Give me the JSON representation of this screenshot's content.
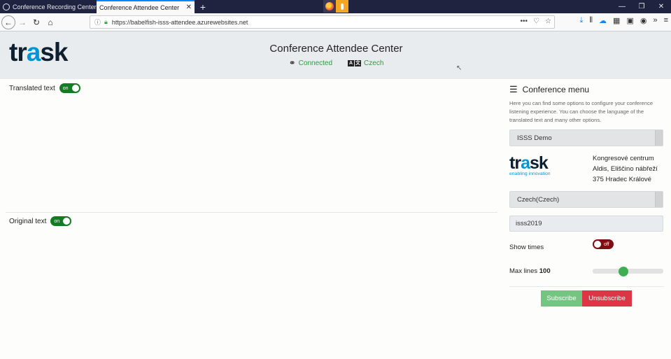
{
  "browser": {
    "tabs": [
      {
        "title": "Conference Recording Center",
        "active": false
      },
      {
        "title": "Conference Attendee Center",
        "active": true
      }
    ],
    "new_tab_icon": "plus-icon",
    "url": "https://babelfish-isss-attendee.azurewebsites.net",
    "window_controls": [
      "minimize-icon",
      "restore-icon",
      "close-icon"
    ]
  },
  "header": {
    "logo": {
      "text_a": "tr",
      "text_b": "a",
      "text_c": "sk"
    },
    "title": "Conference Attendee Center",
    "status_connected": "Connected",
    "status_language": "Czech"
  },
  "panels": {
    "translated_label": "Translated text",
    "translated_switch": "on",
    "original_label": "Original text",
    "original_switch": "on"
  },
  "sidebar": {
    "title": "Conference menu",
    "description": "Here you can find some options to configure your conference listening experience. You can choose the language of the translated text and many other options.",
    "conference_select": "ISSS Demo",
    "venue_logo_tagline": "enabling innovation",
    "venue_lines": [
      "Kongresové centrum",
      "Aldis, Eliščino nábřeží",
      "375 Hradec Králové"
    ],
    "language_select": "Czech(Czech)",
    "code_input": "isss2019",
    "show_times_label": "Show times",
    "show_times_switch": "off",
    "max_lines_label": "Max lines",
    "max_lines_value": "100",
    "max_lines_fraction": 0.43,
    "subscribe_label": "Subscribe",
    "unsubscribe_label": "Unsubscribe"
  },
  "colors": {
    "accent_blue": "#0096d6",
    "connected_green": "#2e9b3f",
    "switch_on": "#117c22",
    "switch_off": "#7f0d12",
    "subscribe": "#74c482",
    "unsubscribe": "#dc3545"
  }
}
